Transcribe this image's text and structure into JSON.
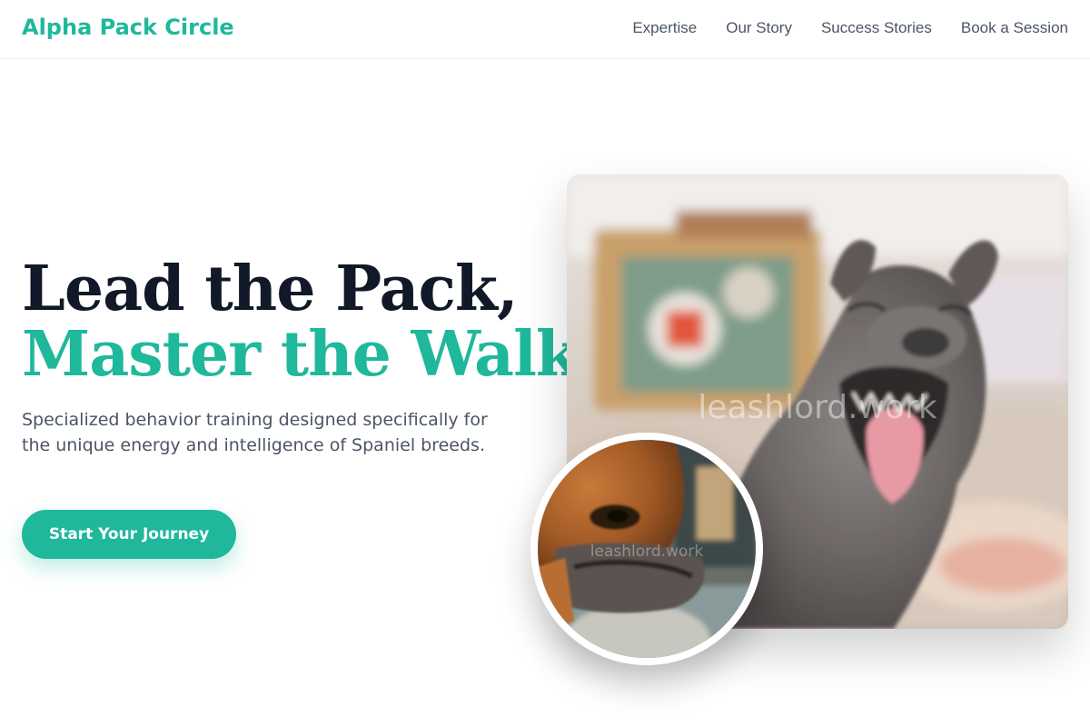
{
  "nav": {
    "brand": "Alpha Pack Circle",
    "links": [
      "Expertise",
      "Our Story",
      "Success Stories",
      "Book a Session"
    ]
  },
  "hero": {
    "headline_line1": "Lead the Pack,",
    "headline_line2": "Master the Walk.",
    "subtitle": "Specialized behavior training designed specifically for the unique energy and intelligence of Spaniel breeds.",
    "cta_label": "Start Your Journey"
  },
  "images": {
    "main_watermark": "leashlord.work",
    "inset_watermark": "leashlord.work"
  },
  "colors": {
    "accent": "#1fb89b",
    "heading": "#111827",
    "body_text": "#4b5563"
  }
}
